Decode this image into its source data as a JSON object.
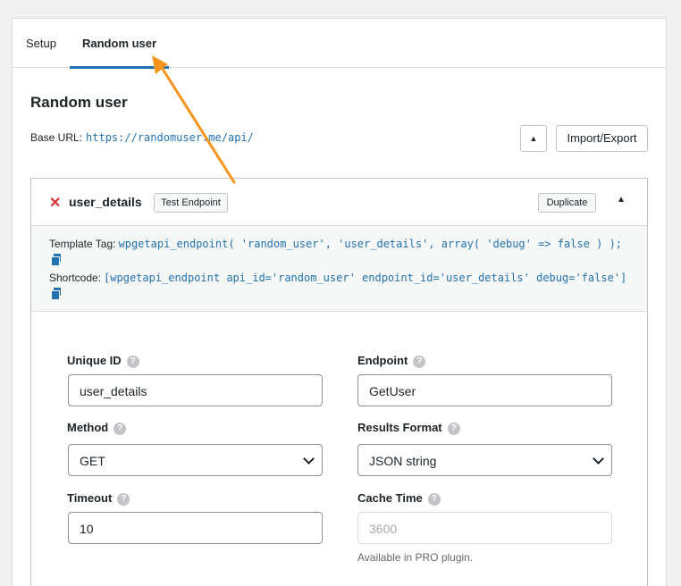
{
  "tabs": [
    {
      "label": "Setup"
    },
    {
      "label": "Random user"
    }
  ],
  "api": {
    "title": "Random user",
    "base_url_label": "Base URL:",
    "base_url": "https://randomuser.me/api/",
    "collapse_icon": "▲",
    "import_export_label": "Import/Export"
  },
  "endpoint": {
    "name": "user_details",
    "test_label": "Test Endpoint",
    "duplicate_label": "Duplicate",
    "toggle_icon": "▲",
    "template_tag_label": "Template Tag:",
    "template_tag": "wpgetapi_endpoint( 'random_user', 'user_details', array( 'debug' => false ) );",
    "shortcode_label": "Shortcode:",
    "shortcode": "[wpgetapi_endpoint api_id='random_user' endpoint_id='user_details' debug='false']"
  },
  "fields": {
    "unique_id": {
      "label": "Unique ID",
      "value": "user_details"
    },
    "endpoint": {
      "label": "Endpoint",
      "value": "GetUser"
    },
    "method": {
      "label": "Method",
      "value": "GET"
    },
    "results_format": {
      "label": "Results Format",
      "value": "JSON string"
    },
    "timeout": {
      "label": "Timeout",
      "value": "10"
    },
    "cache_time": {
      "label": "Cache Time",
      "placeholder": "3600",
      "note": "Available in PRO plugin."
    }
  },
  "help_glyph": "?",
  "colors": {
    "accent": "#2271b1",
    "delete": "#d63638",
    "annotation_arrow": "#f7941d"
  }
}
